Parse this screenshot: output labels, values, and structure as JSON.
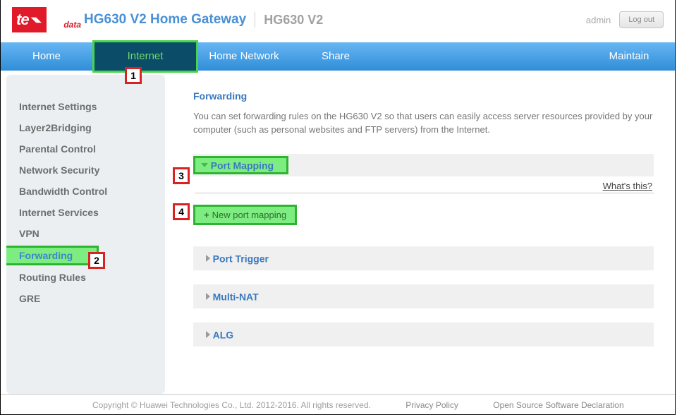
{
  "header": {
    "logo_te": "te",
    "logo_data": "data",
    "title_main": "HG630 V2 Home Gateway",
    "title_sub": "HG630 V2",
    "user": "admin",
    "logout": "Log out"
  },
  "nav": {
    "home": "Home",
    "internet": "Internet",
    "home_network": "Home Network",
    "share": "Share",
    "maintain": "Maintain"
  },
  "sidebar": {
    "items": [
      "Internet Settings",
      "Layer2Bridging",
      "Parental Control",
      "Network Security",
      "Bandwidth Control",
      "Internet Services",
      "VPN",
      "Forwarding",
      "Routing Rules",
      "GRE"
    ]
  },
  "content": {
    "heading": "Forwarding",
    "description": "You can set forwarding rules on the HG630 V2 so that users can easily access server resources provided by your computer (such as personal websites and FTP servers) from the Internet.",
    "port_mapping": "Port Mapping",
    "whats_this": "What's this?",
    "new_port_mapping": "New port mapping",
    "port_trigger": "Port Trigger",
    "multi_nat": "Multi-NAT",
    "alg": "ALG"
  },
  "callouts": {
    "c1": "1",
    "c2": "2",
    "c3": "3",
    "c4": "4"
  },
  "footer": {
    "copyright": "Copyright © Huawei Technologies Co., Ltd. 2012-2016. All rights reserved.",
    "privacy": "Privacy Policy",
    "oss": "Open Source Software Declaration"
  }
}
